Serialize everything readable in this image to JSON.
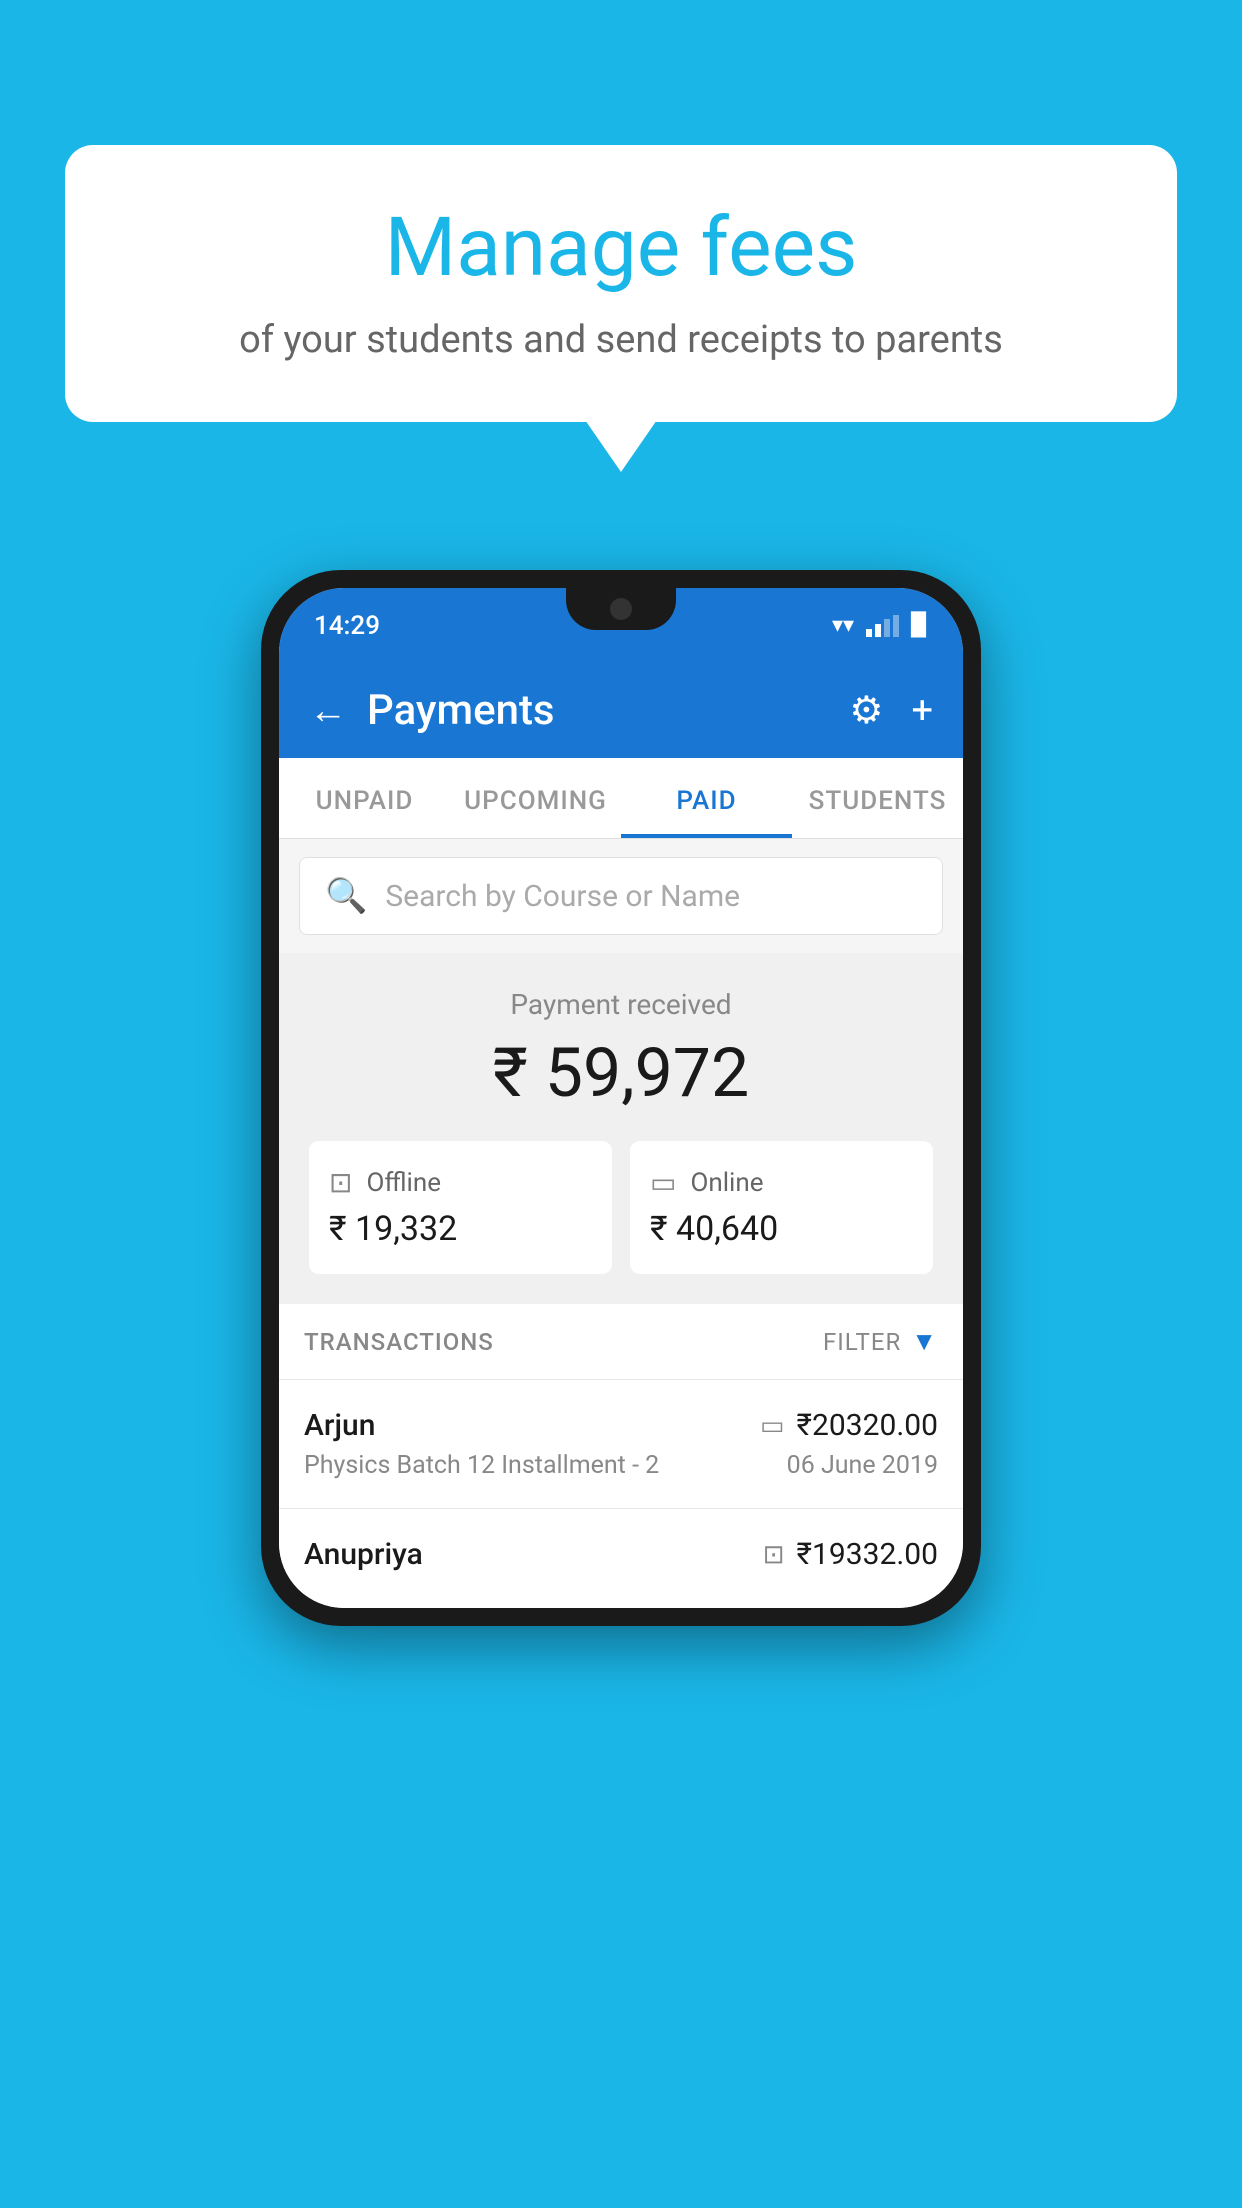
{
  "background_color": "#1ab6e8",
  "speech_bubble": {
    "title": "Manage fees",
    "subtitle": "of your students and send receipts to parents"
  },
  "status_bar": {
    "time": "14:29"
  },
  "app_header": {
    "title": "Payments",
    "back_label": "←",
    "settings_label": "⚙",
    "add_label": "+"
  },
  "tabs": [
    {
      "label": "UNPAID",
      "active": false
    },
    {
      "label": "UPCOMING",
      "active": false
    },
    {
      "label": "PAID",
      "active": true
    },
    {
      "label": "STUDENTS",
      "active": false
    }
  ],
  "search": {
    "placeholder": "Search by Course or Name"
  },
  "payment_summary": {
    "label": "Payment received",
    "amount": "₹ 59,972",
    "offline": {
      "type": "Offline",
      "amount": "₹ 19,332"
    },
    "online": {
      "type": "Online",
      "amount": "₹ 40,640"
    }
  },
  "transactions": {
    "section_label": "TRANSACTIONS",
    "filter_label": "FILTER",
    "items": [
      {
        "name": "Arjun",
        "amount": "₹20320.00",
        "course": "Physics Batch 12 Installment - 2",
        "date": "06 June 2019",
        "payment_type": "card"
      },
      {
        "name": "Anupriya",
        "amount": "₹19332.00",
        "course": "",
        "date": "",
        "payment_type": "offline"
      }
    ]
  }
}
